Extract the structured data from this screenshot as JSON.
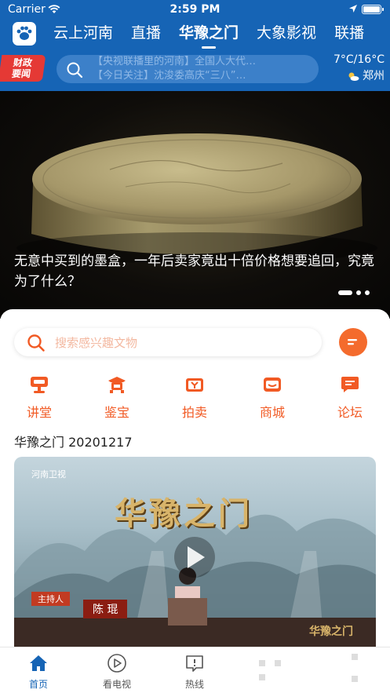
{
  "status": {
    "carrier": "Carrier",
    "time": "2:59 PM"
  },
  "nav": {
    "tabs": [
      "云上河南",
      "直播",
      "华豫之门",
      "大象影视",
      "联播"
    ],
    "active_index": 2
  },
  "badge": {
    "line1": "财政",
    "line2": "要闻"
  },
  "search": {
    "ticker_lines": [
      "【央视联播里的河南】全国人大代…",
      "【今日关注】沈浚委高庆“三八”…"
    ]
  },
  "weather": {
    "temp": "7°C/16°C",
    "city": "郑州"
  },
  "banner": {
    "caption": "无意中买到的墨盒，一年后卖家竟出十倍价格想要追回，究竟为了什么？",
    "dot_count": 3,
    "active_dot": 0
  },
  "panel": {
    "search_placeholder": "搜索感兴趣文物",
    "categories": [
      {
        "label": "讲堂",
        "icon": "lecture-icon"
      },
      {
        "label": "鉴宝",
        "icon": "appraisal-icon"
      },
      {
        "label": "拍卖",
        "icon": "auction-icon"
      },
      {
        "label": "商城",
        "icon": "mall-icon"
      },
      {
        "label": "论坛",
        "icon": "forum-icon"
      }
    ],
    "section_title": "华豫之门 20201217",
    "video": {
      "station": "河南卫视",
      "show_title": "华豫之门",
      "host_tag": "主持人",
      "host_name": "陈 琨",
      "corner_logo": "华豫之门"
    }
  },
  "tabbar": {
    "items": [
      {
        "label": "首页",
        "icon": "home-icon"
      },
      {
        "label": "看电视",
        "icon": "play-icon"
      },
      {
        "label": "热线",
        "icon": "hotline-icon"
      }
    ],
    "active_index": 0
  },
  "colors": {
    "brand_blue": "#1664b5",
    "accent_orange": "#f15a24",
    "badge_red": "#e53935"
  }
}
